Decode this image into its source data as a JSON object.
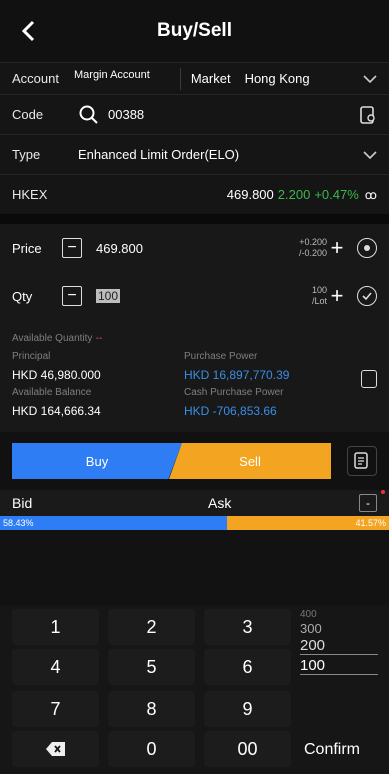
{
  "header": {
    "title": "Buy/Sell"
  },
  "account": {
    "label": "Account",
    "value": "Margin Account",
    "market_label": "Market",
    "market_value": "Hong Kong"
  },
  "code": {
    "label": "Code",
    "value": "00388"
  },
  "type": {
    "label": "Type",
    "value": "Enhanced Limit Order(ELO)"
  },
  "quote": {
    "exchange": "HKEX",
    "price": "469.800",
    "change": "2.200",
    "change_pct": "+0.47%",
    "colors": {
      "up": "#3bb84a"
    }
  },
  "price": {
    "label": "Price",
    "value": "469.800",
    "step_up": "+0.200",
    "step_down": "/-0.200"
  },
  "qty": {
    "label": "Qty",
    "value": "100",
    "lot_top": "100",
    "lot_bottom": "/Lot"
  },
  "funds": {
    "available_qty_label": "Available Quantity",
    "available_qty_value": "--",
    "principal_label": "Principal",
    "principal_value": "HKD 46,980.000",
    "purchase_power_label": "Purchase Power",
    "purchase_power_value": "HKD 16,897,770.39",
    "available_balance_label": "Available Balance",
    "available_balance_value": "HKD 164,666.34",
    "cash_purchase_power_label": "Cash Purchase Power",
    "cash_purchase_power_value": "HKD -706,853.66"
  },
  "actions": {
    "buy": "Buy",
    "sell": "Sell"
  },
  "orderbook": {
    "bid_label": "Bid",
    "ask_label": "Ask",
    "bid_pct": "58.43%",
    "ask_pct": "41.57%"
  },
  "keypad": {
    "keys": [
      "1",
      "2",
      "3",
      "4",
      "5",
      "6",
      "7",
      "8",
      "9",
      "0",
      "00"
    ],
    "confirm": "Confirm",
    "qty_options": [
      "400",
      "300",
      "200",
      "100"
    ]
  }
}
